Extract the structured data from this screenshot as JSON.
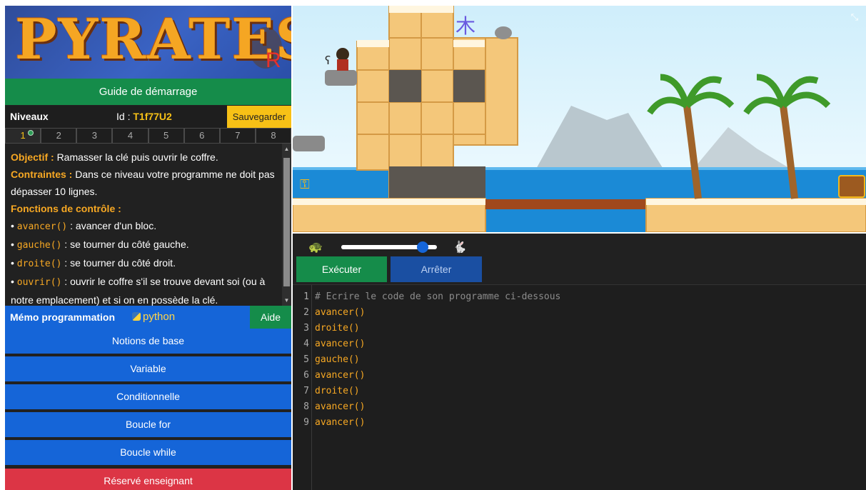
{
  "logo": {
    "text": "PYRATES",
    "badge": "R"
  },
  "guide_label": "Guide de démarrage",
  "levels": {
    "title": "Niveaux",
    "id_label": "Id :",
    "id_value": "T1f77U2",
    "save_label": "Sauvegarder",
    "tabs": [
      "1",
      "2",
      "3",
      "4",
      "5",
      "6",
      "7",
      "8"
    ],
    "active_tab": "1"
  },
  "description": {
    "objective_label": "Objectif :",
    "objective_text": "Ramasser la clé puis ouvrir le coffre.",
    "constraints_label": "Contraintes :",
    "constraints_text": "Dans ce niveau votre programme ne doit pas dépasser 10 lignes.",
    "functions_label": "Fonctions de contrôle :",
    "functions": [
      {
        "code": "avancer()",
        "text": " : avancer d'un bloc."
      },
      {
        "code": "gauche()",
        "text": " : se tourner du côté gauche."
      },
      {
        "code": "droite()",
        "text": " : se tourner du côté droit."
      },
      {
        "code": "ouvrir()",
        "text": " : ouvrir le coffre s'il se trouve devant soi (ou à notre emplacement) et si on en possède la clé."
      }
    ]
  },
  "memo": {
    "title": "Mémo programmation",
    "python_label": "python",
    "help_label": "Aide",
    "buttons": [
      "Notions de base",
      "Variable",
      "Conditionnelle",
      "Boucle for",
      "Boucle while"
    ],
    "teacher_label": "Réservé enseignant"
  },
  "controls": {
    "speed_fraction": 0.85,
    "run_label": "Exécuter",
    "stop_label": "Arrêter",
    "slow_icon": "turtle-icon",
    "fast_icon": "rabbit-icon"
  },
  "editor": {
    "lines": [
      "# Ecrire le code de son programme ci-dessous",
      "avancer()",
      "droite()",
      "avancer()",
      "gauche()",
      "avancer()",
      "droite()",
      "avancer()",
      "avancer()"
    ]
  },
  "colors": {
    "green": "#158c4a",
    "blue": "#1565d8",
    "red": "#dc3545",
    "yellow": "#f7c116",
    "code_orange": "#f7a823"
  }
}
